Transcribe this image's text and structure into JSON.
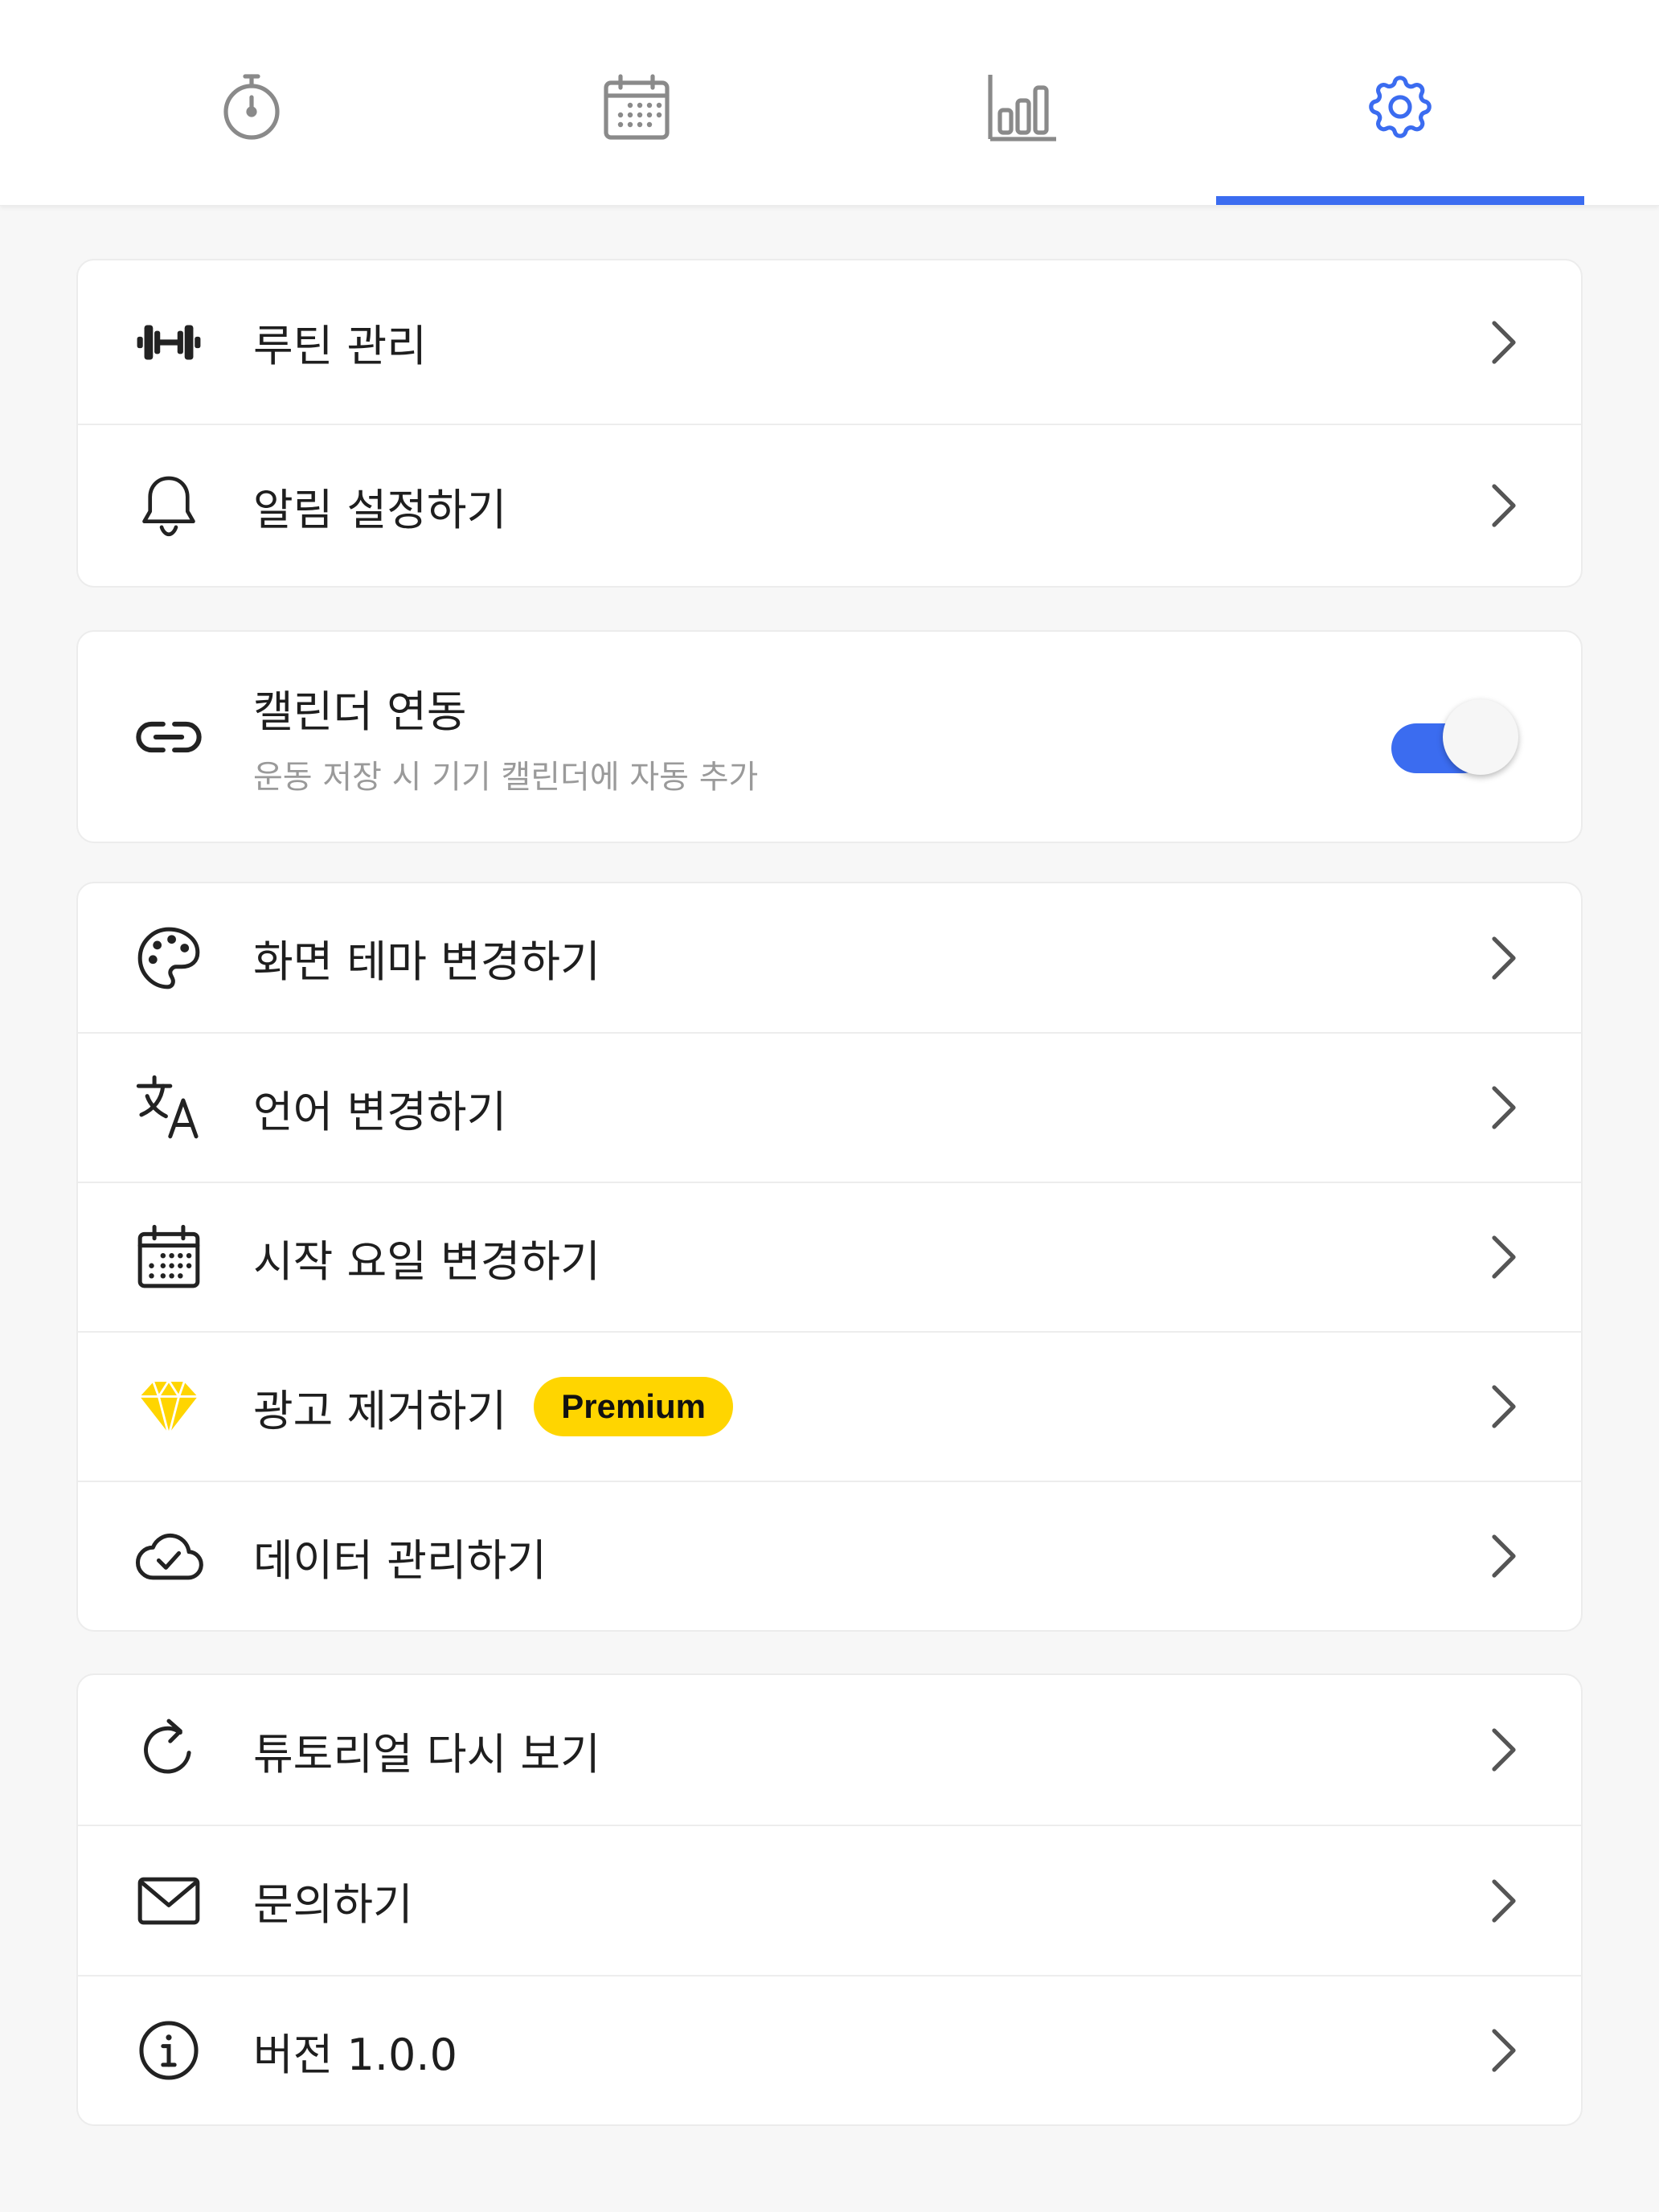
{
  "tabs": [
    {
      "icon": "stopwatch-icon",
      "active": false
    },
    {
      "icon": "calendar-icon",
      "active": false
    },
    {
      "icon": "bar-chart-icon",
      "active": false
    },
    {
      "icon": "gear-icon",
      "active": true
    }
  ],
  "colors": {
    "accent": "#3b6cf0",
    "badge": "#ffd500",
    "diamond": "#ffd500",
    "text": "#1e1e1e",
    "subtext": "#9a9a9a",
    "inactive_icon": "#8a8a8a",
    "background": "#f7f7f7"
  },
  "settings": {
    "group1": [
      {
        "icon": "dumbbell-icon",
        "label": "루틴 관리"
      },
      {
        "icon": "bell-icon",
        "label": "알림 설정하기"
      }
    ],
    "calendar_sync": {
      "icon": "link-icon",
      "label": "캘린더 연동",
      "description": "운동 저장 시 기기 캘린더에 자동 추가",
      "enabled": true
    },
    "group3": [
      {
        "icon": "palette-icon",
        "label": "화면 테마 변경하기"
      },
      {
        "icon": "translate-icon",
        "label": "언어 변경하기"
      },
      {
        "icon": "calendar-icon",
        "label": "시작 요일 변경하기"
      },
      {
        "icon": "diamond-icon",
        "label": "광고 제거하기",
        "badge": "Premium"
      },
      {
        "icon": "cloud-check-icon",
        "label": "데이터 관리하기"
      }
    ],
    "group4": [
      {
        "icon": "refresh-icon",
        "label": "튜토리얼 다시 보기"
      },
      {
        "icon": "mail-icon",
        "label": "문의하기"
      },
      {
        "icon": "info-icon",
        "label": "버전 1.0.0"
      }
    ]
  }
}
